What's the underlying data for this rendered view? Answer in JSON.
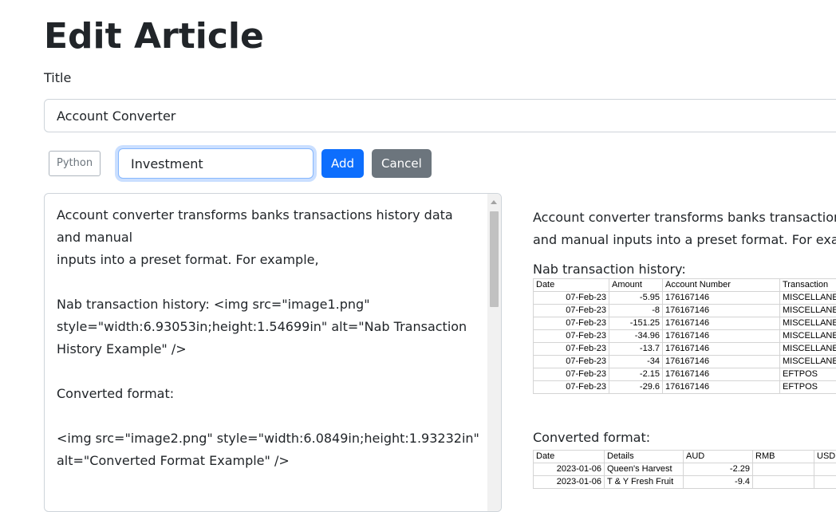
{
  "page": {
    "title": "Edit Article"
  },
  "form": {
    "title_label": "Title",
    "title_value": "Account Converter",
    "tags": [
      "Python"
    ],
    "tag_input_value": "Investment",
    "add_label": "Add",
    "cancel_label": "Cancel"
  },
  "editor": {
    "content": "Account converter transforms banks transactions history data and manual\ninputs into a preset format. For example,\n\nNab transaction history: <img src=\"image1.png\" style=\"width:6.93053in;height:1.54699in\" alt=\"Nab Transaction History Example\" />\n\nConverted format:\n\n<img src=\"image2.png\" style=\"width:6.0849in;height:1.93232in\" alt=\"Converted Format Example\" />"
  },
  "preview": {
    "paragraph_line1": "Account converter transforms banks transactions history data",
    "paragraph_line2": "and manual inputs into a preset format. For example,",
    "nab_heading": "Nab transaction history:",
    "nab_table": {
      "headers": [
        "Date",
        "Amount",
        "Account Number",
        "Transaction"
      ],
      "rows": [
        [
          "07-Feb-23",
          "-5.95",
          "176167146",
          "MISCELLANEOUS"
        ],
        [
          "07-Feb-23",
          "-8",
          "176167146",
          "MISCELLANEOUS"
        ],
        [
          "07-Feb-23",
          "-151.25",
          "176167146",
          "MISCELLANEOUS"
        ],
        [
          "07-Feb-23",
          "-34.96",
          "176167146",
          "MISCELLANEOUS"
        ],
        [
          "07-Feb-23",
          "-13.7",
          "176167146",
          "MISCELLANEOUS"
        ],
        [
          "07-Feb-23",
          "-34",
          "176167146",
          "MISCELLANEOUS"
        ],
        [
          "07-Feb-23",
          "-2.15",
          "176167146",
          "EFTPOS"
        ],
        [
          "07-Feb-23",
          "-29.6",
          "176167146",
          "EFTPOS"
        ]
      ]
    },
    "converted_heading": "Converted format:",
    "converted_table": {
      "headers": [
        "Date",
        "Details",
        "AUD",
        "RMB",
        "USD"
      ],
      "rows": [
        [
          "2023-01-06",
          "Queen's Harvest",
          "-2.29",
          "",
          ""
        ],
        [
          "2023-01-06",
          "T & Y Fresh Fruit",
          "-9.4",
          "",
          ""
        ]
      ]
    }
  }
}
